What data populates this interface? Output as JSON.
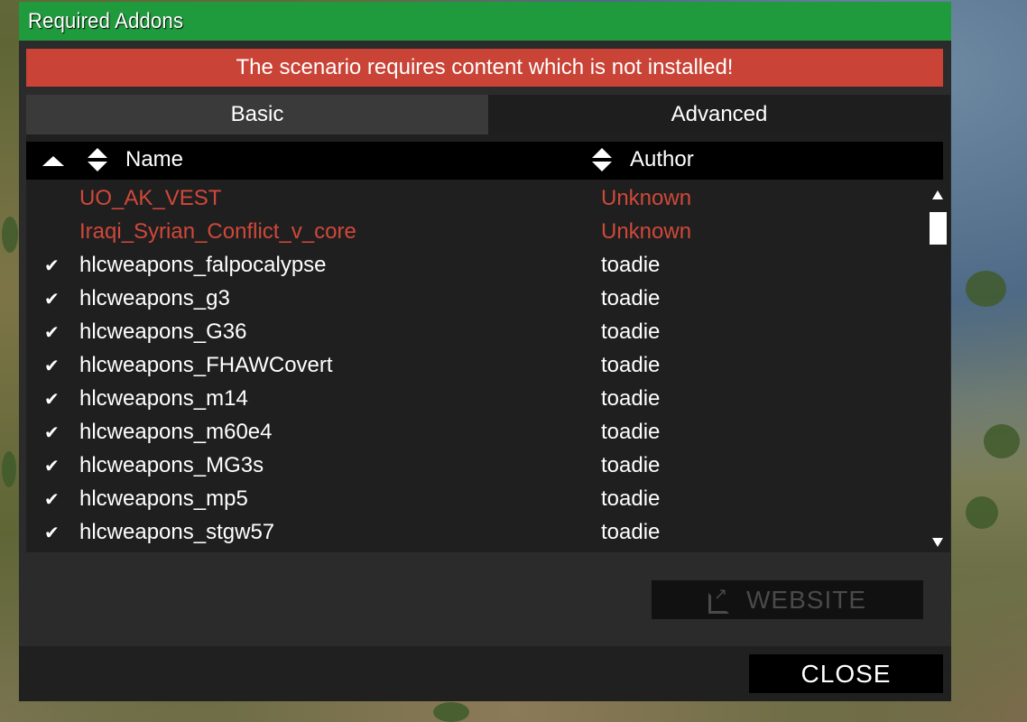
{
  "dialog": {
    "title": "Required Addons",
    "warning": "The scenario requires content which is not installed!",
    "tabs": [
      {
        "label": "Basic",
        "active": true
      },
      {
        "label": "Advanced",
        "active": false
      }
    ],
    "columns": {
      "name": "Name",
      "author": "Author"
    },
    "rows": [
      {
        "name": "UO_AK_VEST",
        "author": "Unknown",
        "installed": false
      },
      {
        "name": "Iraqi_Syrian_Conflict_v_core",
        "author": "Unknown",
        "installed": false
      },
      {
        "name": "hlcweapons_falpocalypse",
        "author": "toadie",
        "installed": true
      },
      {
        "name": "hlcweapons_g3",
        "author": "toadie",
        "installed": true
      },
      {
        "name": "hlcweapons_G36",
        "author": "toadie",
        "installed": true
      },
      {
        "name": "hlcweapons_FHAWCovert",
        "author": "toadie",
        "installed": true
      },
      {
        "name": "hlcweapons_m14",
        "author": "toadie",
        "installed": true
      },
      {
        "name": "hlcweapons_m60e4",
        "author": "toadie",
        "installed": true
      },
      {
        "name": "hlcweapons_MG3s",
        "author": "toadie",
        "installed": true
      },
      {
        "name": "hlcweapons_mp5",
        "author": "toadie",
        "installed": true
      },
      {
        "name": "hlcweapons_stgw57",
        "author": "toadie",
        "installed": true
      }
    ],
    "website_label": "WEBSITE",
    "close_label": "CLOSE"
  },
  "colors": {
    "title_bar": "#1f9a3c",
    "warning": "#c94336",
    "missing_text": "#d0483a"
  },
  "icons": {
    "check": "check-icon",
    "external_link": "external-link-icon"
  }
}
